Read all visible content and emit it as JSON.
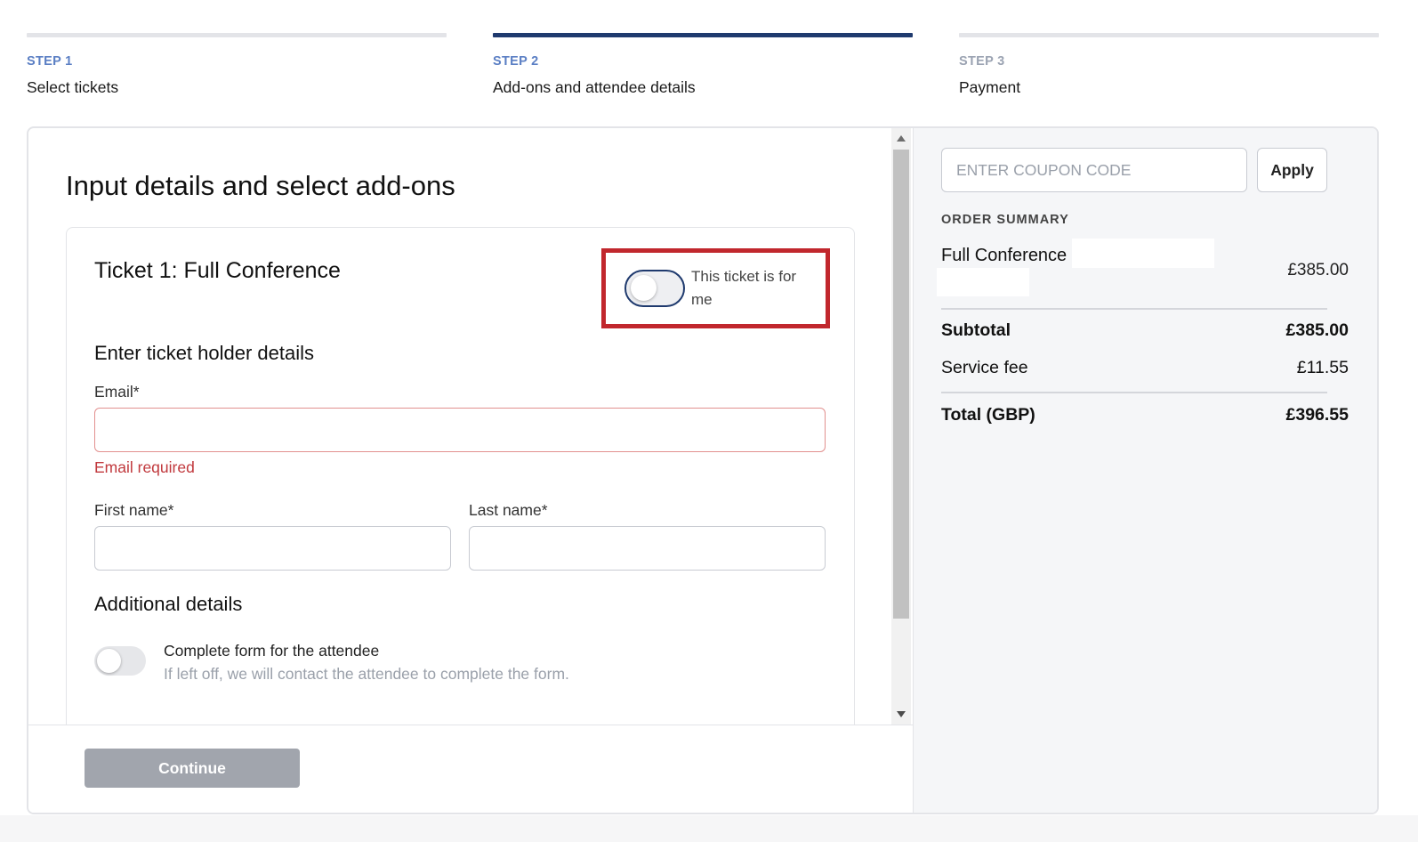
{
  "steps": [
    {
      "kicker": "STEP 1",
      "title": "Select tickets"
    },
    {
      "kicker": "STEP 2",
      "title": "Add-ons and attendee details"
    },
    {
      "kicker": "STEP 3",
      "title": "Payment"
    }
  ],
  "form": {
    "page_title": "Input details and select add-ons",
    "ticket_title": "Ticket 1: Full Conference",
    "me_toggle_label": "This ticket is for me",
    "holder_section": "Enter ticket holder details",
    "email_label": "Email*",
    "email_value": "",
    "email_error": "Email required",
    "first_name_label": "First name*",
    "first_name_value": "",
    "last_name_label": "Last name*",
    "last_name_value": "",
    "additional_section": "Additional details",
    "attendee_toggle_title": "Complete form for the attendee",
    "attendee_toggle_sub": "If left off, we will contact the attendee to complete the form.",
    "continue_label": "Continue"
  },
  "summary": {
    "coupon_placeholder": "ENTER COUPON CODE",
    "coupon_value": "",
    "apply_label": "Apply",
    "heading": "ORDER SUMMARY",
    "item_name": "Full Conference",
    "item_price": "£385.00",
    "subtotal_label": "Subtotal",
    "subtotal_value": "£385.00",
    "fee_label": "Service fee",
    "fee_value": "£11.55",
    "total_label": "Total (GBP)",
    "total_value": "£396.55"
  },
  "colors": {
    "accent": "#1f3a6e",
    "step_kicker": "#5b7fc4",
    "error": "#c1393d",
    "highlight": "#c1272d"
  }
}
